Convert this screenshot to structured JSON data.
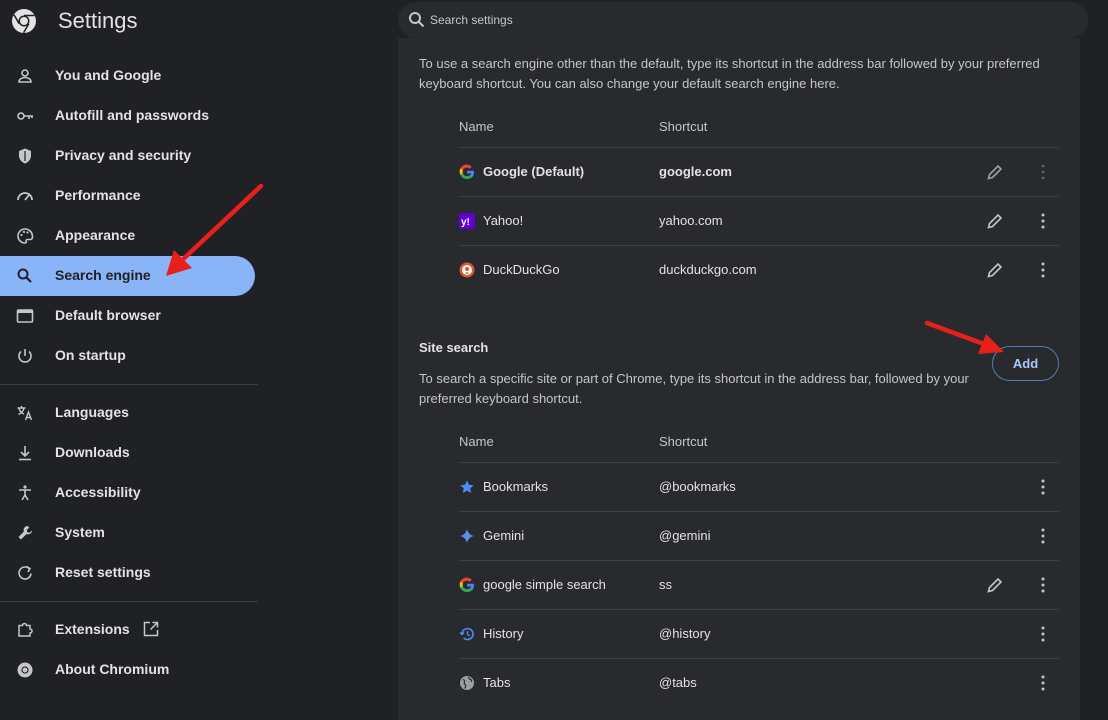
{
  "app": {
    "title": "Settings",
    "search_placeholder": "Search settings"
  },
  "sidebar": {
    "items": [
      {
        "label": "You and Google",
        "icon": "person-icon"
      },
      {
        "label": "Autofill and passwords",
        "icon": "key-icon"
      },
      {
        "label": "Privacy and security",
        "icon": "shield-icon"
      },
      {
        "label": "Performance",
        "icon": "speedometer-icon"
      },
      {
        "label": "Appearance",
        "icon": "palette-icon"
      },
      {
        "label": "Search engine",
        "icon": "search-icon",
        "active": true
      },
      {
        "label": "Default browser",
        "icon": "browser-window-icon"
      },
      {
        "label": "On startup",
        "icon": "power-icon"
      },
      {
        "label": "Languages",
        "icon": "translate-icon"
      },
      {
        "label": "Downloads",
        "icon": "download-icon"
      },
      {
        "label": "Accessibility",
        "icon": "accessibility-icon"
      },
      {
        "label": "System",
        "icon": "wrench-icon"
      },
      {
        "label": "Reset settings",
        "icon": "reset-icon"
      },
      {
        "label": "Extensions",
        "icon": "puzzle-icon"
      },
      {
        "label": "About Chromium",
        "icon": "chromium-icon"
      }
    ]
  },
  "search_engines": {
    "description": "To use a search engine other than the default, type its shortcut in the address bar followed by your preferred keyboard shortcut. You can also change your default search engine here.",
    "col_name": "Name",
    "col_shortcut": "Shortcut",
    "rows": [
      {
        "name": "Google (Default)",
        "shortcut": "google.com",
        "icon": "google-icon"
      },
      {
        "name": "Yahoo!",
        "shortcut": "yahoo.com",
        "icon": "yahoo-icon"
      },
      {
        "name": "DuckDuckGo",
        "shortcut": "duckduckgo.com",
        "icon": "duckduckgo-icon"
      }
    ]
  },
  "site_search": {
    "title": "Site search",
    "add_label": "Add",
    "description": "To search a specific site or part of Chrome, type its shortcut in the address bar, followed by your preferred keyboard shortcut.",
    "col_name": "Name",
    "col_shortcut": "Shortcut",
    "rows": [
      {
        "name": "Bookmarks",
        "shortcut": "@bookmarks",
        "icon": "star-icon"
      },
      {
        "name": "Gemini",
        "shortcut": "@gemini",
        "icon": "gemini-sparkle-icon"
      },
      {
        "name": "google simple search",
        "shortcut": "ss",
        "icon": "google-icon"
      },
      {
        "name": "History",
        "shortcut": "@history",
        "icon": "history-icon"
      },
      {
        "name": "Tabs",
        "shortcut": "@tabs",
        "icon": "globe-icon"
      }
    ]
  },
  "colors": {
    "background": "#202124",
    "panel": "#292a2d",
    "accent": "#8ab4f8",
    "annotation_arrow": "#e8201b"
  }
}
